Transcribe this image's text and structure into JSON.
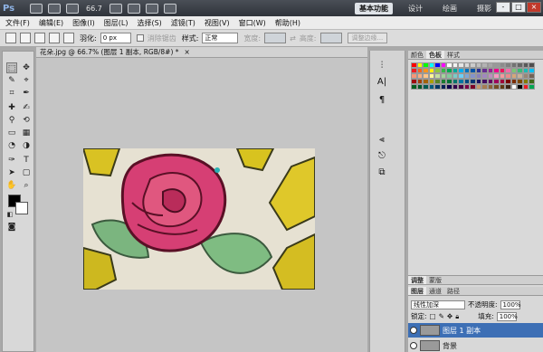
{
  "app": {
    "logo": "Ps",
    "zoom_value": "66.7",
    "workspaces": [
      "基本功能",
      "设计",
      "绘画",
      "摄影"
    ],
    "active_workspace": "基本功能",
    "window_controls": [
      "-",
      "□",
      "×"
    ]
  },
  "menu": {
    "items": [
      "文件(F)",
      "编辑(E)",
      "图像(I)",
      "图层(L)",
      "选择(S)",
      "滤镜(T)",
      "视图(V)",
      "窗口(W)",
      "帮助(H)"
    ]
  },
  "options": {
    "feather_label": "羽化:",
    "feather_value": "0 px",
    "antialias_label": "消除锯齿",
    "style_label": "样式:",
    "style_value": "正常",
    "width_label": "宽度:",
    "height_label": "高度:",
    "refine_edge": "调整边缘..."
  },
  "document": {
    "tab_title": "花朵.jpg @ 66.7% (图层 1 副本, RGB/8#) *",
    "close": "×"
  },
  "panels": {
    "color_tabs": [
      "颜色",
      "色板",
      "样式"
    ],
    "active_color_tab": "色板",
    "swatch_colors": [
      [
        "#ff0000",
        "#ffff00",
        "#00ff00",
        "#00ffff",
        "#0000ff",
        "#ff00ff",
        "#ffffff",
        "#f2f2f2",
        "#e6e6e6",
        "#d9d9d9",
        "#cccccc",
        "#bfbfbf",
        "#b3b3b3",
        "#a6a6a6",
        "#999999",
        "#8c8c8c",
        "#808080",
        "#737373",
        "#666666",
        "#595959",
        "#4d4d4d"
      ],
      [
        "#ee1d24",
        "#f26522",
        "#f7941d",
        "#fff200",
        "#8dc63f",
        "#39b54a",
        "#00a651",
        "#00a99d",
        "#00aeef",
        "#0072bc",
        "#0054a6",
        "#2e3192",
        "#662d91",
        "#92278f",
        "#ec008c",
        "#ed145b",
        "#f06eaa",
        "#7cc576",
        "#3cb878",
        "#1cbbb4",
        "#00bff3"
      ],
      [
        "#f69679",
        "#f9ad81",
        "#fdc689",
        "#fff799",
        "#c4df9b",
        "#a3d39c",
        "#82ca9c",
        "#7accc8",
        "#6dcff6",
        "#7ea7d8",
        "#8393ca",
        "#8781bd",
        "#a187be",
        "#bd8cbf",
        "#f49ac1",
        "#f5989d",
        "#ea8b8b",
        "#d6a77a",
        "#c7b299",
        "#998675",
        "#736357"
      ],
      [
        "#9e0b0f",
        "#a0410d",
        "#a36209",
        "#aba000",
        "#598527",
        "#1a7b30",
        "#007236",
        "#00746b",
        "#0076a3",
        "#004b80",
        "#003471",
        "#1b1464",
        "#440e62",
        "#630460",
        "#9e005d",
        "#9e0039",
        "#790000",
        "#7b2e00",
        "#7d4900",
        "#827b00",
        "#406618"
      ],
      [
        "#005e20",
        "#005826",
        "#005952",
        "#005b7f",
        "#003663",
        "#002157",
        "#0d004c",
        "#32004b",
        "#4b0049",
        "#7b0046",
        "#7a0026",
        "#c69c6d",
        "#a67c52",
        "#8c6239",
        "#754c24",
        "#603913",
        "#3c2415",
        "#ffffff",
        "#000000",
        "#ed1c24",
        "#00a651"
      ]
    ],
    "layers_tabs": [
      "图层",
      "通道",
      "路径"
    ],
    "adjust_tabs": [
      "调整",
      "蒙版"
    ],
    "blend_mode": "线性加深",
    "opacity_label": "不透明度:",
    "opacity_value": "100%",
    "lock_label": "锁定:",
    "fill_label": "填充:",
    "fill_value": "100%",
    "layers": [
      {
        "name": "图层 1 副本",
        "selected": true
      },
      {
        "name": "背景",
        "selected": false
      }
    ]
  }
}
